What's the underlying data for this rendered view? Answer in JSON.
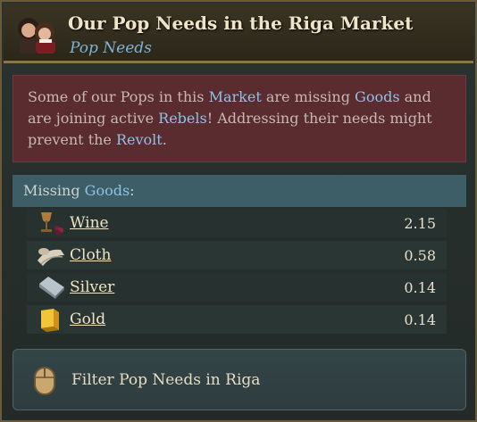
{
  "header": {
    "title": "Our Pop Needs in the Riga Market",
    "subtitle": "Pop Needs",
    "portrait_icon": "pop-portrait-icon"
  },
  "alert": {
    "t1": "Some of our Pops in this ",
    "k1": "Market",
    "t2": " are missing ",
    "k2": "Goods",
    "t3": " and are joining active ",
    "k3": "Rebels",
    "t4": "! Addressing their needs might prevent the ",
    "k4": "Revolt",
    "t5": ".",
    "bg_color": "#5a2c30",
    "keyword_color": "#8cc2e6"
  },
  "missing": {
    "label": "Missing ",
    "keyword": "Goods",
    "suffix": ":"
  },
  "goods": [
    {
      "name": "Wine",
      "value": "2.15",
      "icon": "wine-icon"
    },
    {
      "name": "Cloth",
      "value": "0.58",
      "icon": "cloth-icon"
    },
    {
      "name": "Silver",
      "value": "0.14",
      "icon": "silver-icon"
    },
    {
      "name": "Gold",
      "value": "0.14",
      "icon": "gold-icon"
    }
  ],
  "filter": {
    "label": "Filter Pop Needs in Riga",
    "icon": "mouse-icon"
  }
}
